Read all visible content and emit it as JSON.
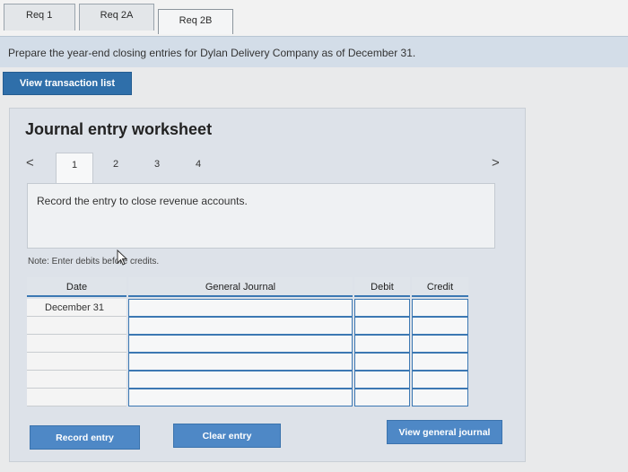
{
  "tabs": [
    {
      "label": "Req 1"
    },
    {
      "label": "Req 2A"
    },
    {
      "label": "Req 2B"
    }
  ],
  "instructions": "Prepare the year-end closing entries for Dylan Delivery Company as of December 31.",
  "view_transaction_list": "View transaction list",
  "worksheet": {
    "title": "Journal entry worksheet",
    "prev": "<",
    "next": ">",
    "steps": [
      "1",
      "2",
      "3",
      "4"
    ],
    "active_step": "1",
    "entry_prompt": "Record the entry to close revenue accounts.",
    "note": "Note: Enter debits before credits."
  },
  "table": {
    "headers": {
      "date": "Date",
      "general_journal": "General Journal",
      "debit": "Debit",
      "credit": "Credit"
    },
    "rows": [
      {
        "date": "December 31",
        "account": "",
        "debit": "",
        "credit": ""
      },
      {
        "date": "",
        "account": "",
        "debit": "",
        "credit": ""
      },
      {
        "date": "",
        "account": "",
        "debit": "",
        "credit": ""
      },
      {
        "date": "",
        "account": "",
        "debit": "",
        "credit": ""
      },
      {
        "date": "",
        "account": "",
        "debit": "",
        "credit": ""
      },
      {
        "date": "",
        "account": "",
        "debit": "",
        "credit": ""
      }
    ]
  },
  "buttons": {
    "record_entry": "Record entry",
    "clear_entry": "Clear entry",
    "view_general_journal": "View general journal"
  },
  "colors": {
    "accent": "#2f6faa",
    "button": "#4e88c6",
    "table_border": "#3c78b3"
  }
}
